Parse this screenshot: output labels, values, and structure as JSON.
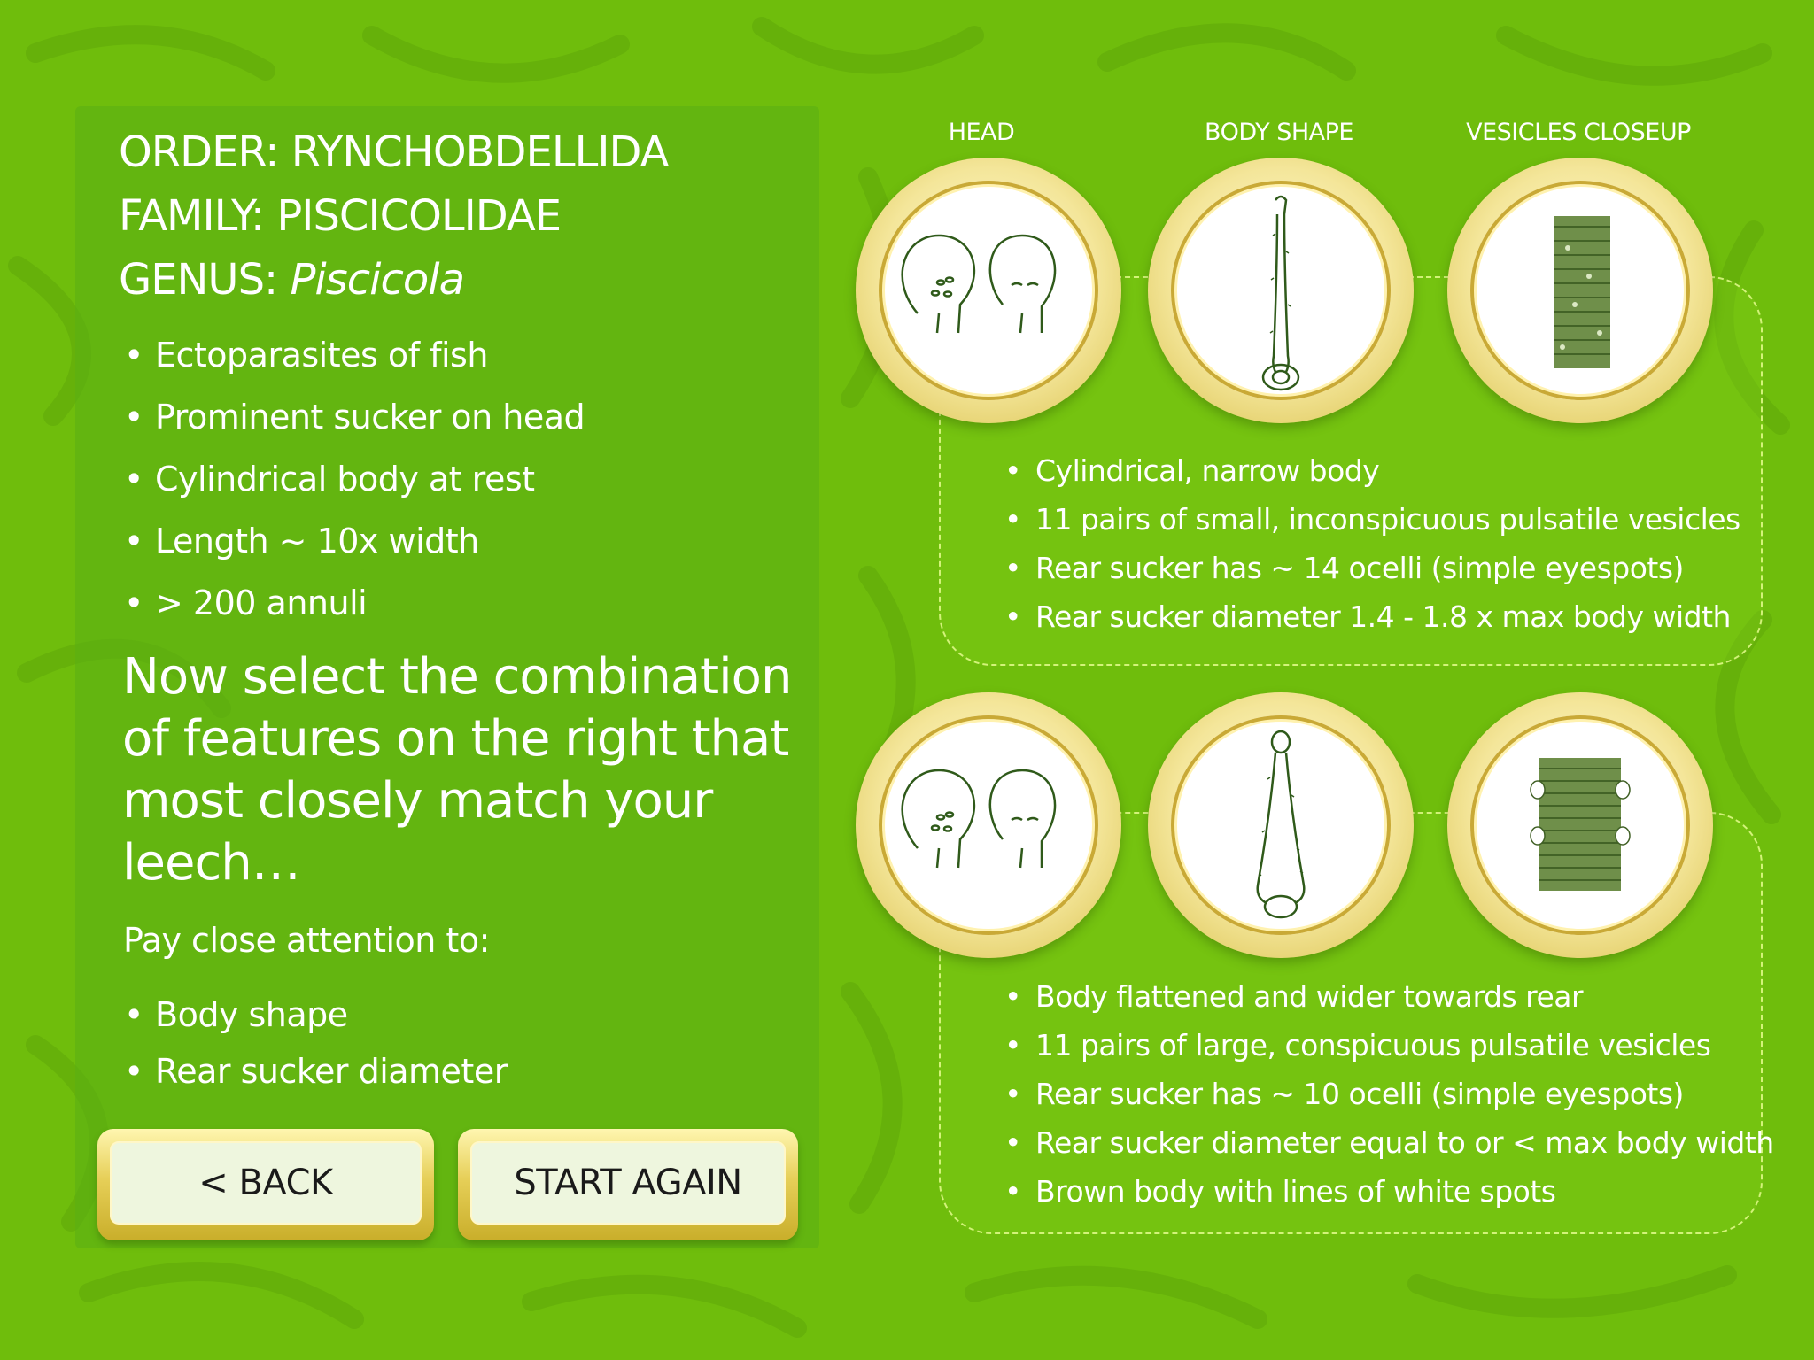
{
  "taxonomy": {
    "order": "ORDER: RYNCHOBDELLIDA",
    "family": "FAMILY: PISCICOLIDAE",
    "genus_prefix": "GENUS: ",
    "genus_name": "Piscicola"
  },
  "facts": [
    "Ectoparasites of fish",
    "Prominent sucker on head",
    "Cylindrical body at rest",
    "Length ~ 10x width",
    "> 200 annuli"
  ],
  "instruction": "Now select the combination of features on the right that most closely match your leech…",
  "attention": {
    "heading": "Pay close attention to:",
    "items": [
      "Body shape",
      "Rear sucker diameter"
    ]
  },
  "buttons": {
    "back": "< BACK",
    "start_again": "START AGAIN"
  },
  "column_labels": {
    "head": "HEAD",
    "body_shape": "BODY SHAPE",
    "vesicles": "VESICLES CLOSEUP"
  },
  "options": [
    {
      "features": [
        "Cylindrical, narrow body",
        "11 pairs of small, inconspicuous pulsatile vesicles",
        "Rear sucker has ~ 14 ocelli (simple eyespots)",
        "Rear sucker diameter 1.4 - 1.8 x max body width"
      ]
    },
    {
      "features": [
        "Body flattened and wider towards rear",
        "11 pairs of large, conspicuous pulsatile vesicles",
        "Rear sucker has ~ 10 ocelli (simple eyespots)",
        "Rear sucker diameter equal to or < max body width",
        "Brown body with lines of white spots"
      ]
    }
  ],
  "colors": {
    "background": "#6fbd0c",
    "text": "#ffffff",
    "button_face": "#eef6de",
    "gold": "#d8bf4a",
    "drawing_ink": "#2f5a1a"
  },
  "icons": [
    "leech-head-icon",
    "leech-body-icon",
    "vesicles-closeup-icon"
  ]
}
